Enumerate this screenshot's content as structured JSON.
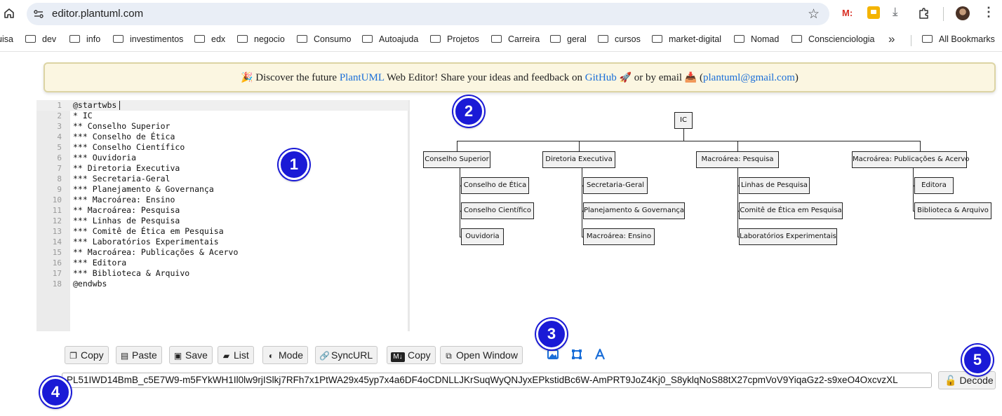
{
  "browser": {
    "url": "editor.plantuml.com",
    "icons": [
      "home-icon",
      "site-settings-icon",
      "bookmark-star-icon",
      "extension-m-icon",
      "notes-icon",
      "download-icon",
      "extensions-puzzle-icon",
      "profile-avatar",
      "more-menu-icon"
    ],
    "ext_m_label": "M:"
  },
  "bookmarks": {
    "items": [
      "uisa",
      "dev",
      "info",
      "investimentos",
      "edx",
      "negocio",
      "Consumo",
      "Autoajuda",
      "Projetos",
      "Carreira",
      "geral",
      "cursos",
      "market-digital",
      "Nomad",
      "Conscienciologia"
    ],
    "more": "»",
    "all": "All Bookmarks"
  },
  "banner": {
    "party": "🎉",
    "t1": "Discover the future",
    "link1": "PlantUML",
    "t2": "Web Editor! Share your ideas and feedback on",
    "link2": "GitHub",
    "rocket": "🚀",
    "t3": "or by email",
    "inbox": "📥",
    "open": "(",
    "email": "plantuml@gmail.com",
    "close": ")"
  },
  "editor": {
    "lines": [
      "@startwbs",
      "* IC",
      "** Conselho Superior",
      "*** Conselho de Ética",
      "*** Conselho Científico",
      "*** Ouvidoria",
      "** Diretoria Executiva",
      "*** Secretaria-Geral",
      "*** Planejamento & Governança",
      "*** Macroárea: Ensino",
      "** Macroárea: Pesquisa",
      "*** Linhas de Pesquisa",
      "*** Comitê de Ética em Pesquisa",
      "*** Laboratórios Experimentais",
      "** Macroárea: Publicações & Acervo",
      "*** Editora",
      "*** Biblioteca & Arquivo",
      "@endwbs"
    ],
    "line_numbers": [
      "1",
      "2",
      "3",
      "4",
      "5",
      "6",
      "7",
      "8",
      "9",
      "10",
      "11",
      "12",
      "13",
      "14",
      "15",
      "16",
      "17",
      "18"
    ]
  },
  "diagram": {
    "root": "IC",
    "branches": [
      {
        "label": "Conselho Superior",
        "children": [
          "Conselho de Ética",
          "Conselho Científico",
          "Ouvidoria"
        ]
      },
      {
        "label": "Diretoria Executiva",
        "children": [
          "Secretaria-Geral",
          "Planejamento & Governança",
          "Macroárea: Ensino"
        ]
      },
      {
        "label": "Macroárea: Pesquisa",
        "children": [
          "Linhas de Pesquisa",
          "Comitê de Ética em Pesquisa",
          "Laboratórios Experimentais"
        ]
      },
      {
        "label": "Macroárea: Publicações & Acervo",
        "children": [
          "Editora",
          "Biblioteca & Arquivo"
        ]
      }
    ]
  },
  "toolbar": {
    "buttons": [
      "Copy",
      "Paste",
      "Save",
      "List",
      "Mode",
      "SyncURL",
      "Copy",
      "Open Window"
    ],
    "tool_icons": [
      "image-icon",
      "crop-frame-icon",
      "font-icon"
    ],
    "md_badge": "M↓"
  },
  "encoded": {
    "value": "PL51IWD14BmB_c5E7W9-m5FYkWH1Il0lw9rjISlkj7RFh7x1PtWA29x45yp7x4a6DF4oCDNLLJKrSuqWyQNJyxEPkstidBc6W-AmPRT9JoZ4Kj0_S8yklqNoS88tX27cpmVoV9YiqaGz2-s9xeO4OxcvzXL"
  },
  "decode_label": "Decode",
  "markers": [
    "1",
    "2",
    "3",
    "4",
    "5"
  ],
  "colors": {
    "marker": "#1a1ad6",
    "link": "#1a6ed8",
    "banner_bg": "#fbf6e1"
  }
}
